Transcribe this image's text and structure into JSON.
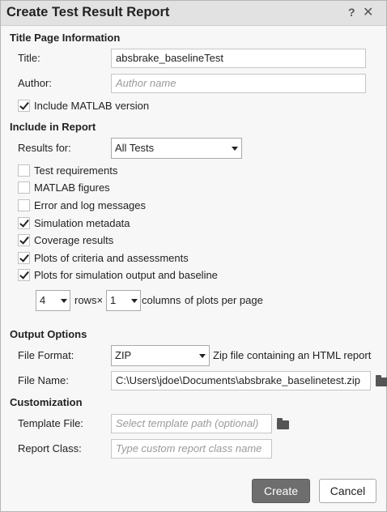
{
  "dialog": {
    "title": "Create Test Result Report",
    "help": "?",
    "close": "✕"
  },
  "title_page": {
    "heading": "Title Page Information",
    "title_label": "Title:",
    "title_value": "absbrake_baselineTest",
    "author_label": "Author:",
    "author_placeholder": "Author name",
    "include_matlab_label": "Include MATLAB version",
    "include_matlab_checked": true
  },
  "include": {
    "heading": "Include in Report",
    "results_for_label": "Results for:",
    "results_for_value": "All Tests",
    "options": [
      {
        "label": "Test requirements",
        "checked": false
      },
      {
        "label": "MATLAB figures",
        "checked": false
      },
      {
        "label": "Error and log messages",
        "checked": false
      },
      {
        "label": "Simulation metadata",
        "checked": true
      },
      {
        "label": "Coverage results",
        "checked": true
      },
      {
        "label": "Plots of criteria and assessments",
        "checked": true
      },
      {
        "label": "Plots for simulation output and baseline",
        "checked": true
      }
    ],
    "rows_value": "4",
    "rows_label": "rows×",
    "cols_value": "1",
    "cols_label": "columns",
    "per_page_label": "of plots per page"
  },
  "output": {
    "heading": "Output Options",
    "format_label": "File Format:",
    "format_value": "ZIP",
    "format_desc": "Zip file containing an HTML report",
    "name_label": "File Name:",
    "name_value": "C:\\Users\\jdoe\\Documents\\absbrake_baselinetest.zip"
  },
  "custom": {
    "heading": "Customization",
    "template_label": "Template File:",
    "template_placeholder": "Select template path (optional)",
    "class_label": "Report Class:",
    "class_placeholder": "Type custom report class name"
  },
  "buttons": {
    "create": "Create",
    "cancel": "Cancel"
  },
  "icons": {
    "folder": "folder-icon",
    "dropdown": "chevron-down-icon",
    "check": "check-icon"
  }
}
